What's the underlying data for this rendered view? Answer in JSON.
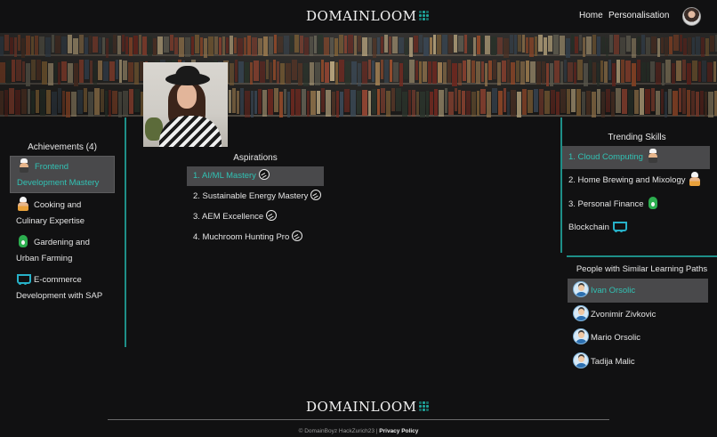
{
  "header": {
    "brand": "DOMAINLOOM",
    "nav": {
      "home": "Home",
      "personalisation": "Personalisation"
    }
  },
  "achievements": {
    "title": "Achievements (4)",
    "items": [
      {
        "label": "Frontend Development Mastery",
        "icon": "chef-icon"
      },
      {
        "label": "Cooking and Culinary Expertise",
        "icon": "cook-icon"
      },
      {
        "label": "Gardening and Urban Farming",
        "icon": "hand-icon"
      },
      {
        "label": "E-commerce Development with SAP",
        "icon": "cart-icon"
      }
    ]
  },
  "aspirations": {
    "title": "Aspirations",
    "items": [
      {
        "label": "1. AI/ML Mastery",
        "icon": "seal-icon"
      },
      {
        "label": "2. Sustainable Energy Mastery",
        "icon": "seal-icon"
      },
      {
        "label": "3. AEM Excellence",
        "icon": "seal-icon"
      },
      {
        "label": "4. Muchroom Hunting Pro",
        "icon": "seal-icon"
      }
    ]
  },
  "trending": {
    "title": "Trending Skills",
    "items": [
      {
        "label": "1. Cloud Computing",
        "icon": "chef-icon"
      },
      {
        "label": "2. Home Brewing and Mixology",
        "icon": "cook-icon"
      },
      {
        "label": "3. Personal Finance",
        "icon": "hand-icon"
      },
      {
        "label": "Blockchain",
        "icon": "cart-icon"
      }
    ]
  },
  "people": {
    "title": "People with Similar Learning Paths",
    "items": [
      {
        "name": "Ivan Orsolic"
      },
      {
        "name": "Zvonimir Zivkovic"
      },
      {
        "name": "Mario Orsolic"
      },
      {
        "name": "Tadija Malic"
      }
    ]
  },
  "footer": {
    "brand": "DOMAINLOOM",
    "copyright": "© DomainBoyz HackZurich23 |",
    "privacy": "Privacy Policy"
  },
  "colors": {
    "accent": "#31c2b4",
    "divider": "#1e8f88",
    "highlight": "#49494b",
    "background": "#111112"
  }
}
